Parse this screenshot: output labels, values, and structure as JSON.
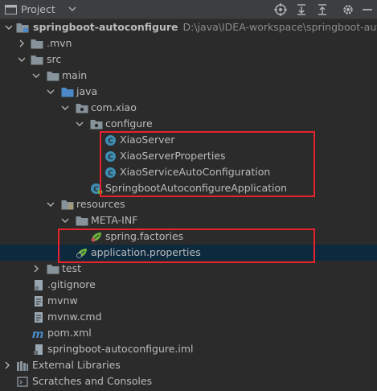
{
  "header": {
    "title": "Project",
    "icons": [
      "project-icon",
      "chevron-down-icon",
      "locate-icon",
      "collapse-all-icon",
      "expand-all-icon",
      "gear-icon",
      "hide-icon"
    ]
  },
  "tree": {
    "root": {
      "label": "springboot-autoconfigure",
      "path": "D:\\java\\IDEA-workspace\\springboot-autoconfigure"
    },
    "mvn": "mvn",
    "src": "src",
    "main": "main",
    "java": "java",
    "pkg": "com.xiao",
    "configure": "configure",
    "class1": "XiaoServer",
    "class2": "XiaoServerProperties",
    "class3": "XiaoServiceAutoConfiguration",
    "appclass": "SpringbootAutoconfigureApplication",
    "resources": "resources",
    "metainf": "META-INF",
    "springfactories": "spring.factories",
    "appprops": "application.properties",
    "test": "test",
    "gitignore": ".gitignore",
    "mvnw": "mvnw",
    "mvnwcmd": "mvnw.cmd",
    "pom": "pom.xml",
    "iml": "springboot-autoconfigure.iml",
    "extlibs": "External Libraries",
    "scratches": "Scratches and Consoles"
  },
  "colors": {
    "folder": "#87939a",
    "source_folder": "#4a88c7",
    "resource_folder": "#b6a25d",
    "class_icon": "#3d8eb5",
    "spring_green": "#6db33f",
    "highlight_box": "#e8232d",
    "selection": "#0d293e"
  }
}
